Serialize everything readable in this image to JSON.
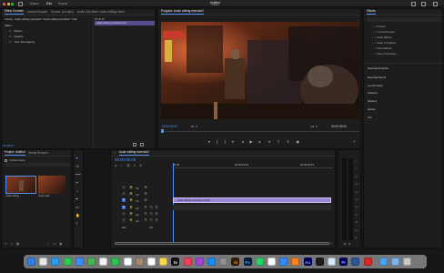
{
  "topbar": {
    "nav": [
      "Import",
      "Edit",
      "Export"
    ],
    "active_nav": "Edit",
    "title_line1": "Untitled",
    "title_line2": "Edited"
  },
  "source_panel": {
    "tabs": [
      "Effect Controls",
      "Lumetri Scopes",
      "Source: (no clips)",
      "Audio Clip Mixer: Audio editing exerci"
    ],
    "clip_line": "Source - Audio editing exercise2 * Audio editing exercise2 * Audi",
    "sequence_label": "Audio editing exercise2.mp4",
    "timecode_small": "00:00:00",
    "section_video": "Video",
    "effects": [
      "Motion",
      "Opacity",
      "Time Remapping"
    ],
    "footer_timecode": "00:00:00"
  },
  "program_panel": {
    "title": "Program: Audio editing exercise2",
    "timecode": "00:00:00:00",
    "fit": "Fit",
    "quality": "1/2",
    "duration": "00:00:09:00"
  },
  "project_panel": {
    "tabs": [
      "Project: Untitled",
      "Media Browser"
    ],
    "file_name": "Untitled.prproj",
    "clip_labels": [
      "Audio editing...",
      "Audio editi..."
    ]
  },
  "timeline": {
    "tab": "Audio editing exercise2",
    "timecode": "00:00:00:00",
    "ruler": [
      "00:00",
      "00:00:04:23",
      "00:00:09:23"
    ],
    "tracks": [
      "V3",
      "V2",
      "V1",
      "A1",
      "A2",
      "A3",
      "Mix"
    ],
    "clip_label": "Audio editing exercise2.mp4 [V]",
    "mix_value": "0.0"
  },
  "effects_panel": {
    "title": "Effects",
    "items": [
      "Presets",
      "Lumetri Presets",
      "Audio Effects",
      "Audio Transitions",
      "Video Effects",
      "Video Transitions"
    ],
    "sections": [
      "Essential Graphics",
      "Essential Sound",
      "Lumetri Color",
      "Libraries",
      "Markers",
      "History",
      "Info"
    ]
  },
  "meters": {
    "labels": [
      "0",
      "-6",
      "-12",
      "-18",
      "-24",
      "-30",
      "-36",
      "-42",
      "-48",
      "-54",
      "dB"
    ]
  },
  "dock": {
    "icons": [
      "finder-icon",
      "launchpad-icon",
      "safari-icon",
      "messages-icon",
      "mail-icon",
      "maps-icon",
      "photos-icon",
      "facetime-icon",
      "calendar-icon",
      "contacts-icon",
      "reminders-icon",
      "notes-icon",
      "tv-icon",
      "music-icon",
      "podcasts-icon",
      "app-store-icon",
      "system-settings-icon",
      "illustrator-icon",
      "photoshop-icon",
      "whatsapp-icon",
      "chrome-icon",
      "zoom-icon",
      "vlc-icon",
      "audition-icon",
      "terminal-icon",
      "preview-icon",
      "premiere-icon",
      "word-icon",
      "acrobat-icon",
      "downloads-icon",
      "finder-folder-icon",
      "trash-icon"
    ],
    "labels": {
      "tv": "tv",
      "ai": "Ai",
      "ps": "Ps",
      "au": "Au",
      "pr": "Pr"
    },
    "colors": [
      "#2f7fe8",
      "#e9e9e9",
      "#2a9cf4",
      "#31c95a",
      "#3a8ef5",
      "#4bb256",
      "#f4f4f4",
      "#2ec24f",
      "#ffffff",
      "#a58b6b",
      "#ffffff",
      "#f8d94c",
      "#111111",
      "#f2405b",
      "#a246d8",
      "#1a8cf5",
      "#8e8e93",
      "#2f1d05",
      "#001e36",
      "#25d366",
      "#ffffff",
      "#2d8cff",
      "#f58220",
      "#00005b",
      "#1c1c1c",
      "#d9e6f5",
      "#00005b",
      "#2b579a",
      "#d62a22",
      "#4aa3f2",
      "#7ab3f0",
      "#c8c8c8"
    ]
  }
}
